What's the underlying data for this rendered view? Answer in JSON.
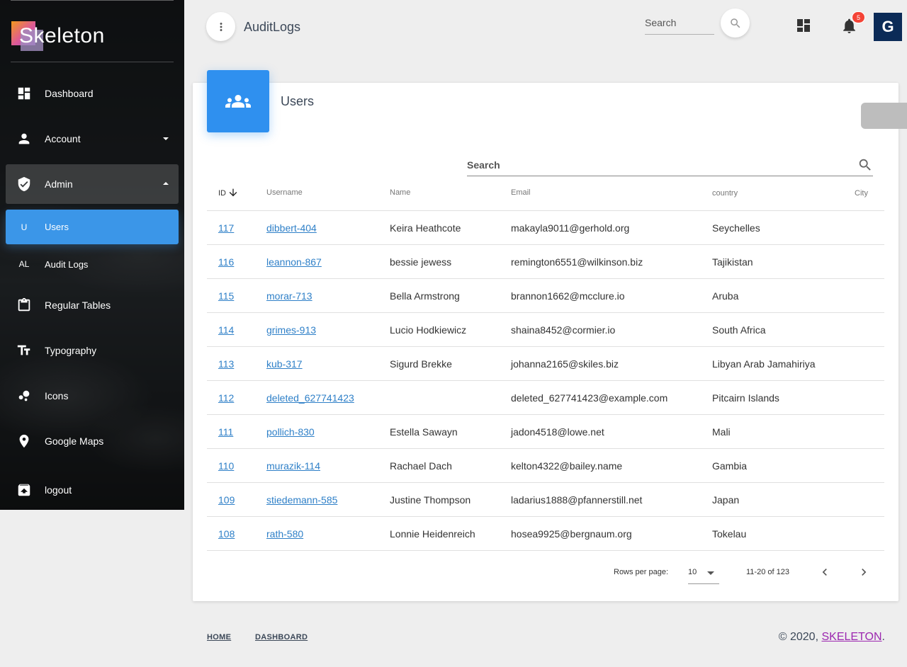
{
  "brand": {
    "name": "Skeleton"
  },
  "sidebar": {
    "items": [
      {
        "label": "Dashboard",
        "icon": "dashboard-icon"
      },
      {
        "label": "Account",
        "icon": "person-icon"
      },
      {
        "label": "Admin",
        "icon": "shield-icon"
      },
      {
        "label": "Users",
        "mini": "U"
      },
      {
        "label": "Audit Logs",
        "mini": "AL"
      },
      {
        "label": "Regular Tables",
        "icon": "clipboard-icon"
      },
      {
        "label": "Typography",
        "icon": "typography-icon"
      },
      {
        "label": "Icons",
        "icon": "bubbles-icon"
      },
      {
        "label": "Google Maps",
        "icon": "location-pin-icon"
      },
      {
        "label": "logout",
        "icon": "logout-icon"
      }
    ]
  },
  "header": {
    "title": "AuditLogs",
    "search_placeholder": "Search",
    "notification_count": "5",
    "avatar_letter": "G"
  },
  "card": {
    "title": "Users",
    "search_placeholder": "Search"
  },
  "table": {
    "columns": [
      "ID",
      "Username",
      "Name",
      "Email",
      "country",
      "City"
    ],
    "rows": [
      {
        "id": "117",
        "username": "dibbert-404",
        "name": "Keira Heathcote",
        "email": "makayla9011@gerhold.org",
        "country": "Seychelles",
        "city": ""
      },
      {
        "id": "116",
        "username": "leannon-867",
        "name": "bessie jewess",
        "email": "remington6551@wilkinson.biz",
        "country": "Tajikistan",
        "city": ""
      },
      {
        "id": "115",
        "username": "morar-713",
        "name": "Bella Armstrong",
        "email": "brannon1662@mcclure.io",
        "country": "Aruba",
        "city": ""
      },
      {
        "id": "114",
        "username": "grimes-913",
        "name": "Lucio Hodkiewicz",
        "email": "shaina8452@cormier.io",
        "country": "South Africa",
        "city": ""
      },
      {
        "id": "113",
        "username": "kub-317",
        "name": "Sigurd Brekke",
        "email": "johanna2165@skiles.biz",
        "country": "Libyan Arab Jamahiriya",
        "city": ""
      },
      {
        "id": "112",
        "username": "deleted_627741423",
        "name": "",
        "email": "deleted_627741423@example.com",
        "country": "Pitcairn Islands",
        "city": ""
      },
      {
        "id": "111",
        "username": "pollich-830",
        "name": "Estella Sawayn",
        "email": "jadon4518@lowe.net",
        "country": "Mali",
        "city": ""
      },
      {
        "id": "110",
        "username": "murazik-114",
        "name": "Rachael Dach",
        "email": "kelton4322@bailey.name",
        "country": "Gambia",
        "city": ""
      },
      {
        "id": "109",
        "username": "stiedemann-585",
        "name": "Justine Thompson",
        "email": "ladarius1888@pfannerstill.net",
        "country": "Japan",
        "city": ""
      },
      {
        "id": "108",
        "username": "rath-580",
        "name": "Lonnie Heidenreich",
        "email": "hosea9925@bergnaum.org",
        "country": "Tokelau",
        "city": ""
      }
    ]
  },
  "pagination": {
    "rows_per_page_label": "Rows per page:",
    "rows_per_page_value": "10",
    "range": "11-20 of 123"
  },
  "footer": {
    "links": [
      "HOME",
      "DASHBOARD"
    ],
    "copyright_prefix": "© 2020,",
    "copyright_brand": "SKELETON",
    "copyright_suffix": "."
  },
  "colors": {
    "accent": "#3b96e8",
    "card_icon": "#2f90ef",
    "badge": "#f44336",
    "avatar_bg": "#0b2b57",
    "link": "#2f80c8",
    "copyright_link": "#9c27b0"
  }
}
